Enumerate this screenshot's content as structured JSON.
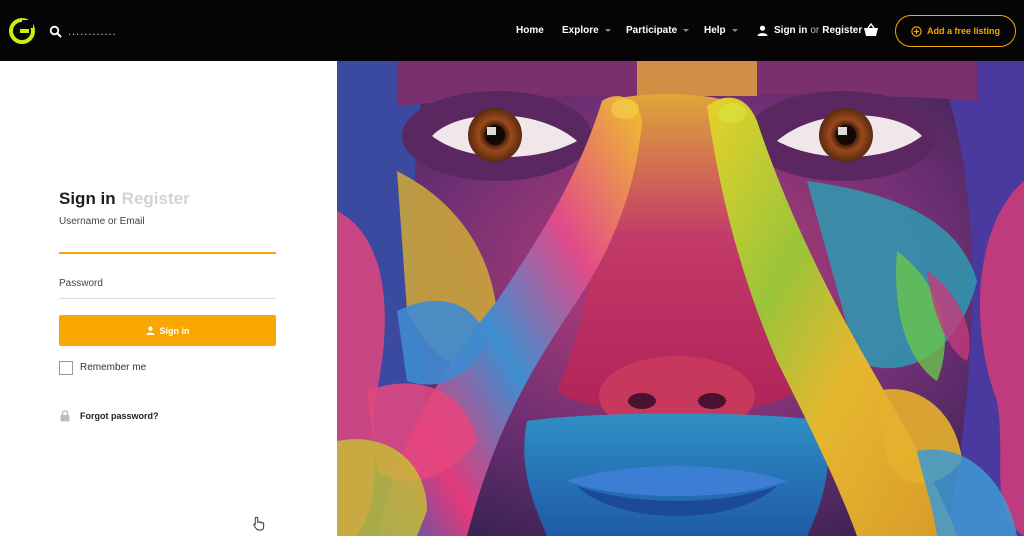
{
  "header": {
    "search_placeholder": "............",
    "nav": [
      {
        "label": "Home",
        "has_dropdown": false
      },
      {
        "label": "Explore",
        "has_dropdown": true
      },
      {
        "label": "Participate",
        "has_dropdown": true
      },
      {
        "label": "Help",
        "has_dropdown": true
      }
    ],
    "sign_in_label": "Sign in",
    "or_label": "or",
    "register_label": "Register",
    "add_listing_label": "Add a free listing",
    "accent_color": "#f6a800",
    "icons": [
      "logo-icon",
      "search-icon",
      "user-icon",
      "basket-icon",
      "plus-circle-icon"
    ]
  },
  "login": {
    "tab_signin": "Sign in",
    "tab_register": "Register",
    "username_label": "Username or Email",
    "username_value": "",
    "password_label": "Password",
    "password_value": "",
    "signin_button": "Sign in",
    "remember_label": "Remember me",
    "remember_checked": false,
    "forgot_label": "Forgot password?",
    "button_color": "#f7a700"
  },
  "hero": {
    "image_subject": "face-covered-in-colorful-paint-with-hands"
  }
}
